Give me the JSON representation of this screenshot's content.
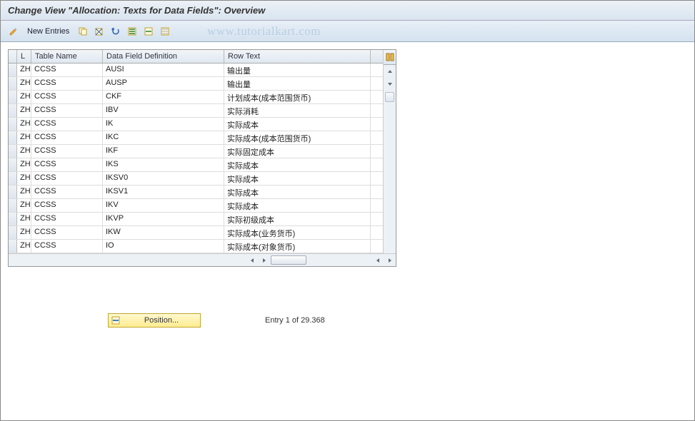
{
  "title": "Change View \"Allocation: Texts for Data Fields\": Overview",
  "toolbar": {
    "new_entries": "New Entries"
  },
  "watermark": "www.tutorialkart.com",
  "table": {
    "headers": {
      "l": "L",
      "table_name": "Table Name",
      "data_field_definition": "Data Field Definition",
      "row_text": "Row Text"
    },
    "rows": [
      {
        "l": "ZH",
        "tn": "CCSS",
        "dfd": "AUSI",
        "rt": "输出量"
      },
      {
        "l": "ZH",
        "tn": "CCSS",
        "dfd": "AUSP",
        "rt": "输出量"
      },
      {
        "l": "ZH",
        "tn": "CCSS",
        "dfd": "CKF",
        "rt": "计划成本(成本范围货币)"
      },
      {
        "l": "ZH",
        "tn": "CCSS",
        "dfd": "IBV",
        "rt": "实际消耗"
      },
      {
        "l": "ZH",
        "tn": "CCSS",
        "dfd": "IK",
        "rt": "实际成本"
      },
      {
        "l": "ZH",
        "tn": "CCSS",
        "dfd": "IKC",
        "rt": "实际成本(成本范围货币)"
      },
      {
        "l": "ZH",
        "tn": "CCSS",
        "dfd": "IKF",
        "rt": "实际固定成本"
      },
      {
        "l": "ZH",
        "tn": "CCSS",
        "dfd": "IKS",
        "rt": "实际成本"
      },
      {
        "l": "ZH",
        "tn": "CCSS",
        "dfd": "IKSV0",
        "rt": "实际成本"
      },
      {
        "l": "ZH",
        "tn": "CCSS",
        "dfd": "IKSV1",
        "rt": "实际成本"
      },
      {
        "l": "ZH",
        "tn": "CCSS",
        "dfd": "IKV",
        "rt": "实际成本"
      },
      {
        "l": "ZH",
        "tn": "CCSS",
        "dfd": "IKVP",
        "rt": "实际初级成本"
      },
      {
        "l": "ZH",
        "tn": "CCSS",
        "dfd": "IKW",
        "rt": "实际成本(业务货币)"
      },
      {
        "l": "ZH",
        "tn": "CCSS",
        "dfd": "IO",
        "rt": "实际成本(对象货币)"
      }
    ]
  },
  "footer": {
    "position_label": "Position...",
    "entry_text": "Entry 1 of 29.368"
  }
}
